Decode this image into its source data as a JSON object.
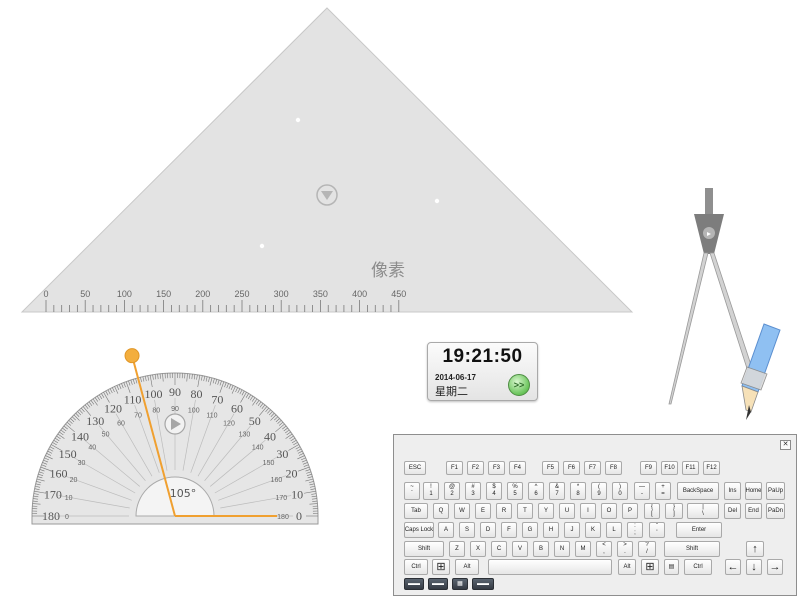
{
  "set_square": {
    "label": "像素",
    "scale_numbers": [
      "0",
      "50",
      "100",
      "150",
      "200",
      "250",
      "300",
      "350",
      "400",
      "450"
    ]
  },
  "protractor": {
    "angle_readout": "105°",
    "outer_scale": [
      "180",
      "170",
      "160",
      "150",
      "140",
      "130",
      "120",
      "110",
      "100",
      "90",
      "80",
      "70",
      "60",
      "50",
      "40",
      "30",
      "20",
      "10",
      "0"
    ],
    "inner_scale": [
      "0",
      "10",
      "20",
      "30",
      "40",
      "50",
      "60",
      "70",
      "80",
      "90",
      "100",
      "110",
      "120",
      "130",
      "140",
      "150",
      "160",
      "170",
      "180"
    ],
    "angle_value": 105,
    "accent_color": "#f0a030"
  },
  "clock": {
    "time": "19:21:50",
    "date": "2014-06-17",
    "weekday": "星期二",
    "go_label": ">>",
    "go_color": "#5cbf4c"
  },
  "keyboard": {
    "close_label": "✕",
    "row1": [
      {
        "id": "esc",
        "label": "ESC"
      },
      {
        "id": "f1",
        "label": "F1"
      },
      {
        "id": "f2",
        "label": "F2"
      },
      {
        "id": "f3",
        "label": "F3"
      },
      {
        "id": "f4",
        "label": "F4"
      },
      {
        "id": "f5",
        "label": "F5"
      },
      {
        "id": "f6",
        "label": "F6"
      },
      {
        "id": "f7",
        "label": "F7"
      },
      {
        "id": "f8",
        "label": "F8"
      },
      {
        "id": "f9",
        "label": "F9"
      },
      {
        "id": "f10",
        "label": "F10"
      },
      {
        "id": "f11",
        "label": "F11"
      },
      {
        "id": "f12",
        "label": "F12"
      }
    ],
    "row2": [
      {
        "id": "tilde",
        "top": "~",
        "bottom": "`"
      },
      {
        "id": "1",
        "top": "!",
        "bottom": "1"
      },
      {
        "id": "2",
        "top": "@",
        "bottom": "2"
      },
      {
        "id": "3",
        "top": "#",
        "bottom": "3"
      },
      {
        "id": "4",
        "top": "$",
        "bottom": "4"
      },
      {
        "id": "5",
        "top": "%",
        "bottom": "5"
      },
      {
        "id": "6",
        "top": "^",
        "bottom": "6"
      },
      {
        "id": "7",
        "top": "&",
        "bottom": "7"
      },
      {
        "id": "8",
        "top": "*",
        "bottom": "8"
      },
      {
        "id": "9",
        "top": "(",
        "bottom": "9"
      },
      {
        "id": "0",
        "top": ")",
        "bottom": "0"
      },
      {
        "id": "minus",
        "top": "—",
        "bottom": "-"
      },
      {
        "id": "equals",
        "top": "+",
        "bottom": "="
      },
      {
        "id": "backspace",
        "label": "BackSpace"
      },
      {
        "id": "ins",
        "label": "Ins"
      },
      {
        "id": "home",
        "label": "Home"
      },
      {
        "id": "pgup",
        "label": "PaUp"
      }
    ],
    "row3": [
      {
        "id": "tab",
        "label": "Tab"
      },
      {
        "id": "q",
        "label": "Q"
      },
      {
        "id": "w",
        "label": "W"
      },
      {
        "id": "e",
        "label": "E"
      },
      {
        "id": "r",
        "label": "R"
      },
      {
        "id": "t",
        "label": "T"
      },
      {
        "id": "y",
        "label": "Y"
      },
      {
        "id": "u",
        "label": "U"
      },
      {
        "id": "i",
        "label": "I"
      },
      {
        "id": "o",
        "label": "O"
      },
      {
        "id": "p",
        "label": "P"
      },
      {
        "id": "lbracket",
        "top": "{",
        "bottom": "["
      },
      {
        "id": "rbracket",
        "top": "}",
        "bottom": "]"
      },
      {
        "id": "backslash",
        "top": "|",
        "bottom": "\\"
      },
      {
        "id": "del",
        "label": "Del"
      },
      {
        "id": "end",
        "label": "End"
      },
      {
        "id": "pgdn",
        "label": "PaDn"
      }
    ],
    "row4": [
      {
        "id": "capslock",
        "label": "Caps Lock"
      },
      {
        "id": "a",
        "label": "A"
      },
      {
        "id": "s",
        "label": "S"
      },
      {
        "id": "d",
        "label": "D"
      },
      {
        "id": "f",
        "label": "F"
      },
      {
        "id": "g",
        "label": "G"
      },
      {
        "id": "h",
        "label": "H"
      },
      {
        "id": "j",
        "label": "J"
      },
      {
        "id": "k",
        "label": "K"
      },
      {
        "id": "l",
        "label": "L"
      },
      {
        "id": "semicolon",
        "top": ":",
        "bottom": ";"
      },
      {
        "id": "quote",
        "top": "\"",
        "bottom": "'"
      },
      {
        "id": "enter",
        "label": "Enter"
      }
    ],
    "row5": [
      {
        "id": "lshift",
        "label": "Shift"
      },
      {
        "id": "z",
        "label": "Z"
      },
      {
        "id": "x",
        "label": "X"
      },
      {
        "id": "c",
        "label": "C"
      },
      {
        "id": "v",
        "label": "V"
      },
      {
        "id": "b",
        "label": "B"
      },
      {
        "id": "n",
        "label": "N"
      },
      {
        "id": "m",
        "label": "M"
      },
      {
        "id": "comma",
        "top": "<",
        "bottom": ","
      },
      {
        "id": "period",
        "top": ">",
        "bottom": "."
      },
      {
        "id": "slash",
        "top": "?",
        "bottom": "/"
      },
      {
        "id": "rshift",
        "label": "Shift"
      },
      {
        "id": "up",
        "label": "↑"
      }
    ],
    "row6": [
      {
        "id": "lctrl",
        "label": "Ctrl"
      },
      {
        "id": "lwin",
        "label": "⊞"
      },
      {
        "id": "lalt",
        "label": "Alt"
      },
      {
        "id": "space",
        "label": ""
      },
      {
        "id": "ralt",
        "label": "Alt"
      },
      {
        "id": "rwin",
        "label": "⊞"
      },
      {
        "id": "menu",
        "label": "▤"
      },
      {
        "id": "rctrl",
        "label": "Ctrl"
      },
      {
        "id": "left",
        "label": "←"
      },
      {
        "id": "down",
        "label": "↓"
      },
      {
        "id": "right",
        "label": "→"
      }
    ],
    "mode_buttons": [
      {
        "id": "mode1",
        "label": "▬▬"
      },
      {
        "id": "mode2",
        "label": "▬▬"
      },
      {
        "id": "mode3",
        "label": "▦"
      },
      {
        "id": "mode4",
        "label": "▬▬"
      }
    ]
  }
}
